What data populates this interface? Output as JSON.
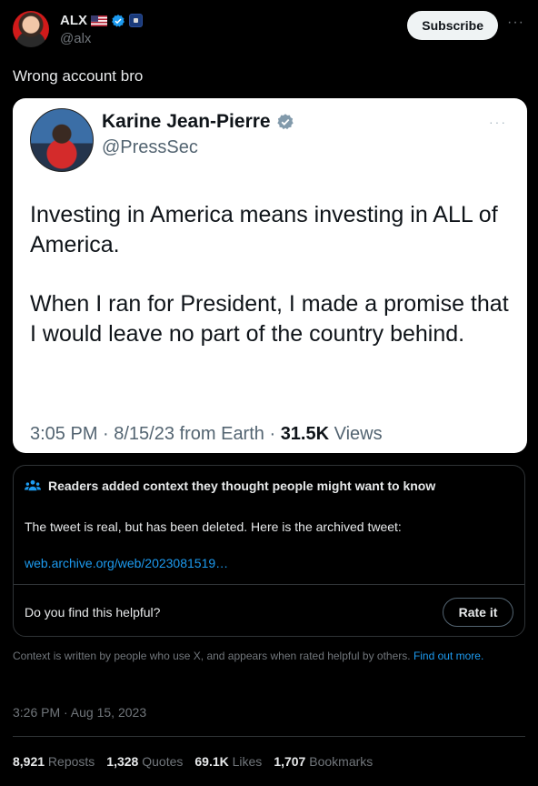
{
  "author": {
    "name": "ALX",
    "handle": "@alx",
    "flag_icon": "us-flag-icon",
    "verified_icon": "verified-badge-icon",
    "affiliate_icon": "affiliate-badge-icon"
  },
  "actions": {
    "subscribe_label": "Subscribe",
    "more_label": "···"
  },
  "tweet": {
    "text": "Wrong account bro"
  },
  "embedded": {
    "name": "Karine Jean-Pierre",
    "handle": "@PressSec",
    "more_label": "···",
    "paragraph1": "Investing in America means investing in ALL of America.",
    "paragraph2": "When I ran for President, I made a promise that I would leave no part of the country behind.",
    "meta_prefix": "3:05 PM · 8/15/23 from Earth · ",
    "views_count": "31.5K",
    "views_label": " Views"
  },
  "community_note": {
    "header": "Readers added context they thought people might want to know",
    "body": "The tweet is real, but has been deleted. Here is the archived tweet:",
    "link": "web.archive.org/web/2023081519…",
    "helpful_question": "Do you find this helpful?",
    "rate_label": "Rate it"
  },
  "disclaimer": {
    "text": "Context is written by people who use X, and appears when rated helpful by others. ",
    "link": "Find out more."
  },
  "timestamp": "3:26 PM · Aug 15, 2023",
  "stats": {
    "reposts_count": "8,921",
    "reposts_label": " Reposts",
    "quotes_count": "1,328",
    "quotes_label": " Quotes",
    "likes_count": "69.1K",
    "likes_label": " Likes",
    "bookmarks_count": "1,707",
    "bookmarks_label": " Bookmarks"
  },
  "colors": {
    "background": "#000000",
    "accent": "#1d9bf0",
    "text": "#e7e9ea",
    "muted": "#71767b"
  }
}
